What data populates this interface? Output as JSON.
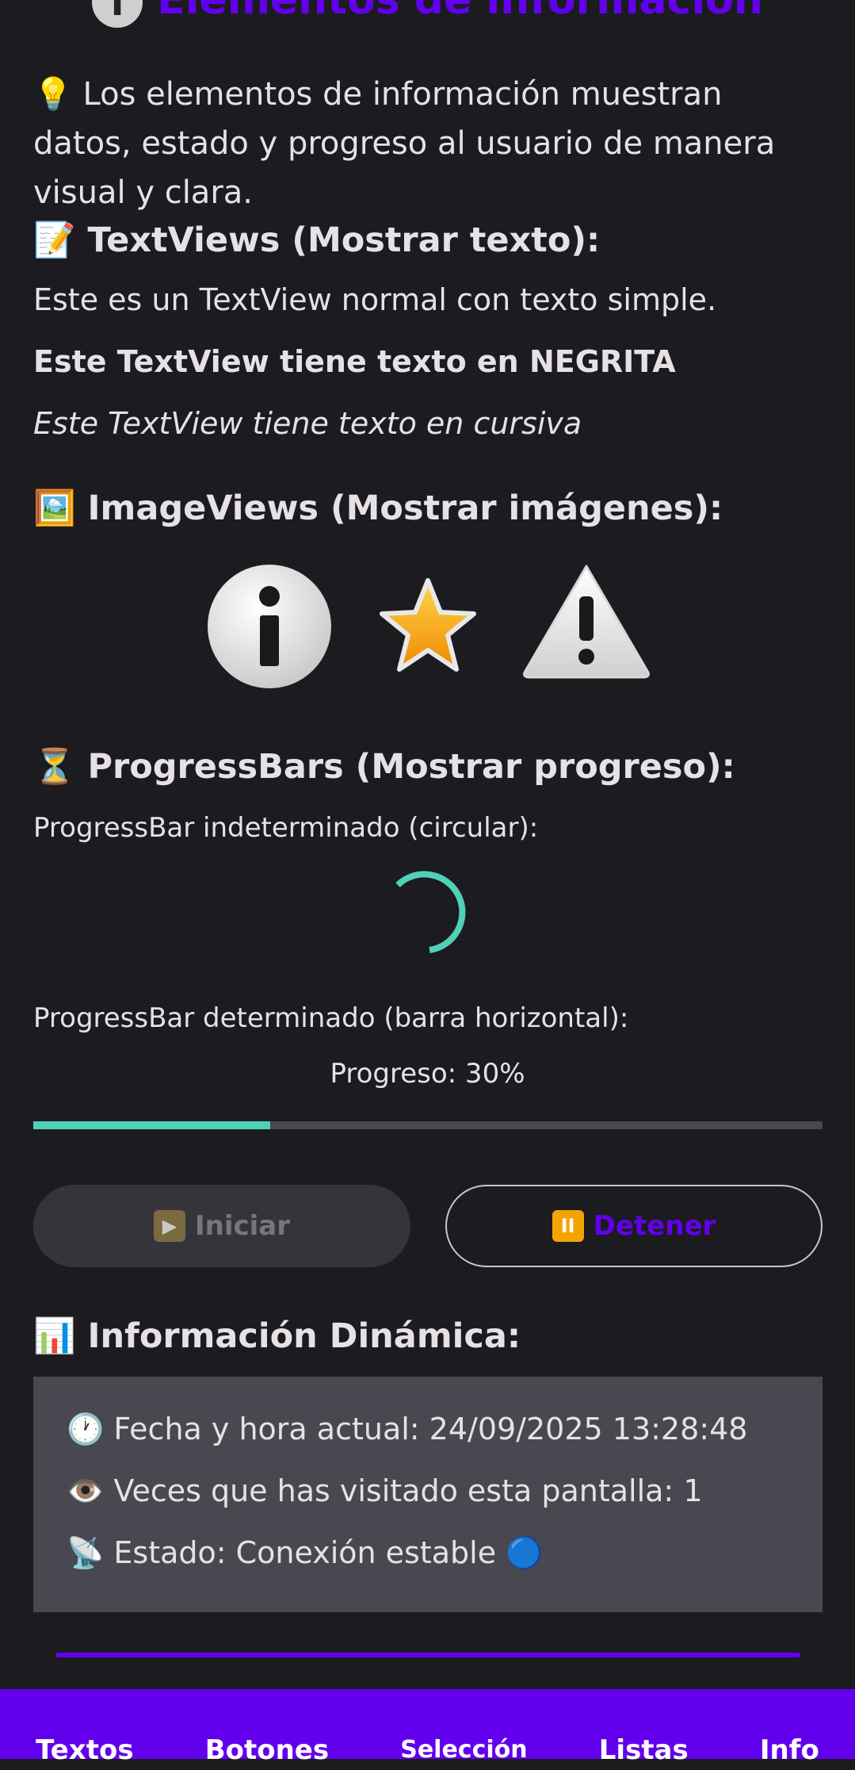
{
  "header": {
    "title": "Elementos de información",
    "title_icon": "info-icon"
  },
  "intro": "💡 Los elementos de información muestran datos, estado y progreso al usuario de manera visual y clara.",
  "textviews": {
    "heading": "📝 TextViews (Mostrar texto):",
    "normal": "Este es un TextView normal con texto simple.",
    "bold": "Este TextView tiene texto en NEGRITA",
    "italic": "Este TextView tiene texto en cursiva"
  },
  "imageviews": {
    "heading": "🖼️ ImageViews (Mostrar imágenes):",
    "images": [
      "info-icon",
      "star-icon",
      "warning-icon"
    ]
  },
  "progressbars": {
    "heading": "⏳ ProgressBars (Mostrar progreso):",
    "indeterminate_label": "ProgressBar indeterminado (circular):",
    "determinate_label": "ProgressBar determinado (barra horizontal):",
    "progress_text": "Progreso: 30%",
    "progress_value": 0.3,
    "accent_color": "#4fd1b7"
  },
  "buttons": {
    "start_label": "Iniciar",
    "start_icon": "play-icon",
    "stop_label": "Detener",
    "stop_icon": "pause-icon"
  },
  "dynamic": {
    "heading": "📊 Información Dinámica:",
    "datetime": "🕐 Fecha y hora actual: 24/09/2025 13:28:48",
    "visits": "👁️ Veces que has visitado esta pantalla: 1",
    "status": "📡 Estado: Conexión estable 🔵"
  },
  "nav": {
    "items": [
      "Textos",
      "Botones",
      "Selección",
      "Listas",
      "Info"
    ],
    "color": "#6200ee"
  }
}
